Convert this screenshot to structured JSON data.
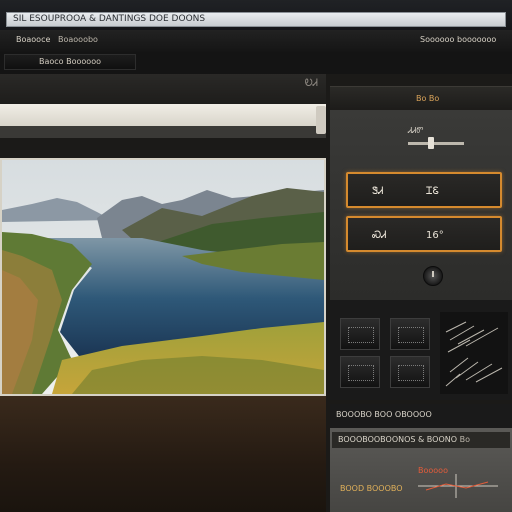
{
  "window": {
    "title": "SIL ESOUPROOA & DANTINGS  DOE  DOONS"
  },
  "toolbar": {
    "left_label": "Boaooce",
    "mid_label": "Boaooobo",
    "right_label": "Soooooo booooooo"
  },
  "breadcrumb": {
    "label": "Baoco Boooooo"
  },
  "left_header": {
    "mark": "ᎧᏗ"
  },
  "right_panel": {
    "header_label": "Bo Bo",
    "slider_label": "ᏗᏗᏛ",
    "field_a_left": "ᏕᏗ",
    "field_a_right": "ᏆᏋ",
    "field_b_left": "ᏍᏗ",
    "field_b_right": "16°",
    "info_title": "BOOOBO BOO OBOOOO",
    "info_bar_left": "BOOOBOOBOONOS & BOONO",
    "info_bar_right": "Bo",
    "info_red": "Booooo",
    "info_red2": "BOOD BOOOBO"
  },
  "colors": {
    "accent_orange": "#d58a2e",
    "panel_dark": "#1a1a1a",
    "lake_blue": "#1f3a5c"
  },
  "icons": {
    "slider": "slider-icon",
    "knob": "dial-knob-icon",
    "photo": "mountain-lake-image"
  }
}
